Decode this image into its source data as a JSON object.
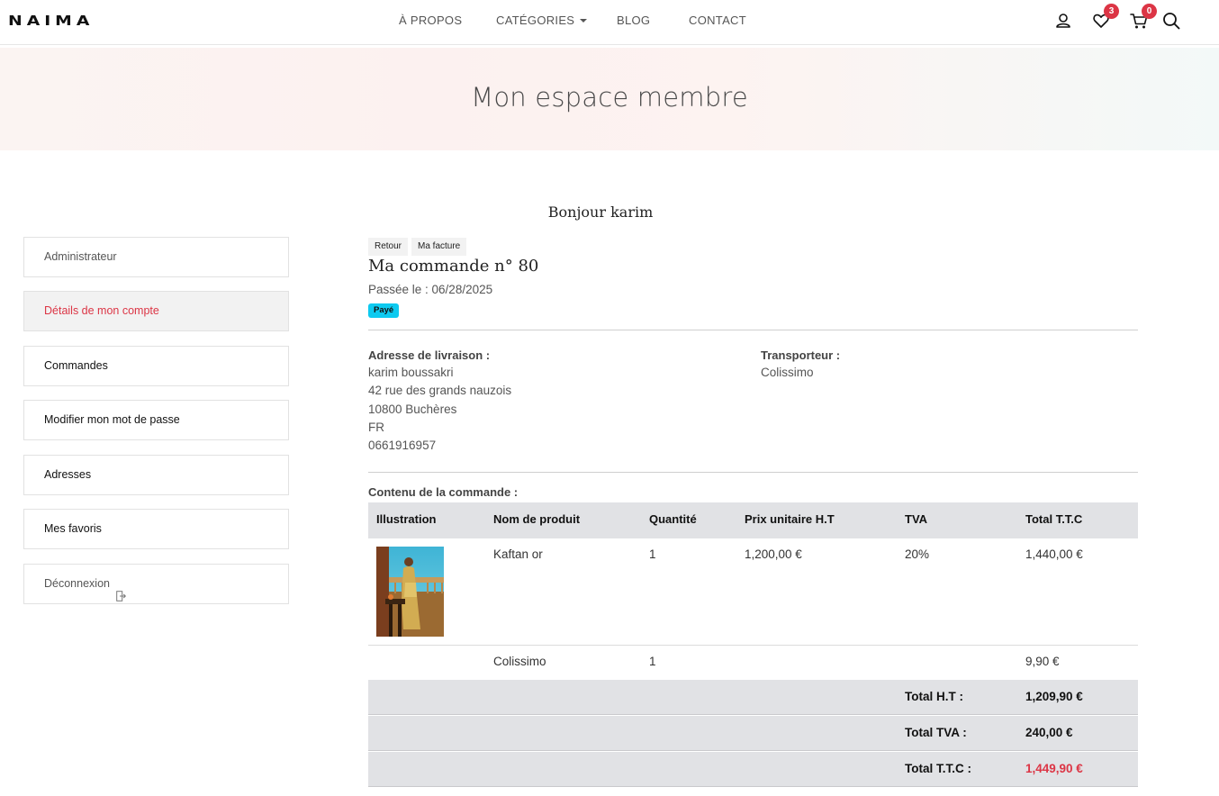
{
  "header": {
    "logo": "NAIMA",
    "nav": [
      {
        "label": "À PROPOS"
      },
      {
        "label": "CATÉGORIES"
      },
      {
        "label": "BLOG"
      },
      {
        "label": "CONTACT"
      }
    ],
    "wishlist_count": "3",
    "cart_count": "0",
    "icons": [
      "user-icon",
      "heart-icon",
      "cart-icon",
      "search-icon"
    ]
  },
  "banner": {
    "title": "Mon espace membre"
  },
  "greeting": "Bonjour karim",
  "sidebar": {
    "items": [
      {
        "label": "Administrateur"
      },
      {
        "label": "Détails de mon compte"
      },
      {
        "label": "Commandes"
      },
      {
        "label": "Modifier mon mot de passe"
      },
      {
        "label": "Adresses"
      },
      {
        "label": "Mes favoris"
      },
      {
        "label": "Déconnexion"
      }
    ]
  },
  "order": {
    "back_label": "Retour",
    "invoice_label": "Ma facture",
    "title": "Ma commande n° 80",
    "date": "Passée le : 06/28/2025",
    "status": "Payé",
    "shipping_label": "Adresse de livraison :",
    "shipping_lines": [
      "karim boussakri",
      "42 rue des grands nauzois",
      "10800 Buchères",
      "FR",
      "0661916957"
    ],
    "carrier_label": "Transporteur :",
    "carrier": "Colissimo",
    "content_label": "Contenu de la commande :",
    "columns": [
      "Illustration",
      "Nom de produit",
      "Quantité",
      "Prix unitaire H.T",
      "TVA",
      "Total T.T.C"
    ],
    "rows": [
      {
        "name": "Kaftan or",
        "qty": "1",
        "unit_price": "1,200,00 €",
        "tva": "20%",
        "total": "1,440,00 €"
      },
      {
        "name": "Colissimo",
        "qty": "1",
        "unit_price": "",
        "tva": "",
        "total": "9,90 €"
      }
    ],
    "totals": [
      {
        "label": "Total H.T :",
        "value": "1,209,90 €"
      },
      {
        "label": "Total TVA :",
        "value": "240,00 €"
      },
      {
        "label": "Total T.T.C :",
        "value": "1,449,90 €"
      }
    ]
  },
  "colors": {
    "accent": "#dc3545",
    "status": "#0dcaf0",
    "table_head": "#e1e2e5"
  }
}
